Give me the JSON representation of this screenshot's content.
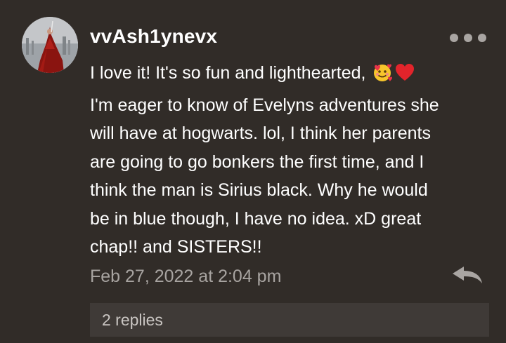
{
  "comment": {
    "username": "vvAsh1ynevx",
    "body_lines": [
      "I love it! It's so fun and lighthearted,",
      "I'm eager to know of Evelyns adventures she",
      "will have at hogwarts. lol, I think her parents",
      "are going to go bonkers the first time, and I",
      "think the man is Sirius black. Why he would",
      "be in blue though, I have no idea. xD great",
      "chap!! and SISTERS!!"
    ],
    "emojis": [
      "smiling-face-with-hearts",
      "red-heart"
    ],
    "timestamp": "Feb 27, 2022 at 2:04 pm",
    "replies_label": "2 replies"
  },
  "icons": {
    "more": "more-options-icon",
    "reply": "reply-arrow-icon"
  },
  "colors": {
    "background": "#312c28",
    "text": "#ffffff",
    "muted_text": "#a8a4a1",
    "replies_bar": "#3f3a37",
    "icon_gray": "#a9a5a2"
  }
}
